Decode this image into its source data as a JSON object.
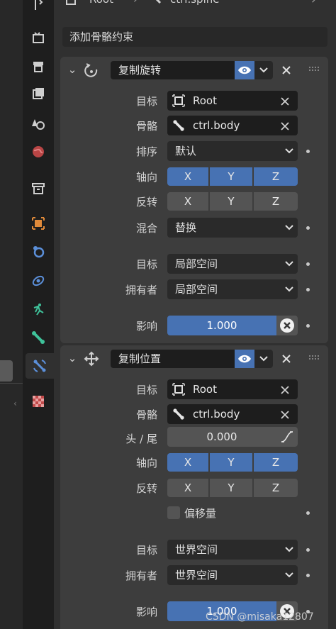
{
  "breadcrumb": {
    "object": "Root",
    "bone": "ctrl.spine"
  },
  "add_constraint_label": "添加骨骼约束",
  "constraints": [
    {
      "name": "复制旋转",
      "target_label": "目标",
      "target_value": "Root",
      "bone_label": "骨骼",
      "bone_value": "ctrl.body",
      "order_label": "排序",
      "order_value": "默认",
      "axis_label": "轴向",
      "axes": [
        "X",
        "Y",
        "Z"
      ],
      "invert_label": "反转",
      "invert": [
        "X",
        "Y",
        "Z"
      ],
      "mix_label": "混合",
      "mix_value": "替换",
      "target_space_label": "目标",
      "target_space_value": "局部空间",
      "owner_space_label": "拥有者",
      "owner_space_value": "局部空间",
      "influence_label": "影响",
      "influence_value": "1.000"
    },
    {
      "name": "复制位置",
      "target_label": "目标",
      "target_value": "Root",
      "bone_label": "骨骼",
      "bone_value": "ctrl.body",
      "headtail_label": "头 / 尾",
      "headtail_value": "0.000",
      "axis_label": "轴向",
      "axes": [
        "X",
        "Y",
        "Z"
      ],
      "invert_label": "反转",
      "invert": [
        "X",
        "Y",
        "Z"
      ],
      "offset_label": "偏移量",
      "target_space_label": "目标",
      "target_space_value": "世界空间",
      "owner_space_label": "拥有者",
      "owner_space_value": "世界空间",
      "influence_label": "影响",
      "influence_value": "1.000"
    }
  ],
  "watermark": "CSDN @misaka12807",
  "colors": {
    "accent": "#4772b3",
    "panel": "#3d3d3d",
    "field": "#1d1d1d"
  }
}
